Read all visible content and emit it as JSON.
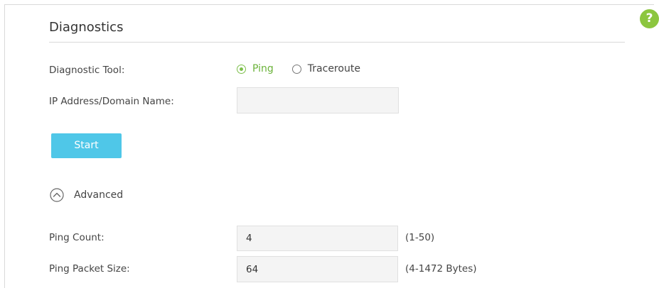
{
  "section": {
    "title": "Diagnostics",
    "help_label": "?"
  },
  "diagnostic_tool": {
    "label": "Diagnostic Tool:",
    "options": [
      {
        "label": "Ping",
        "checked": true
      },
      {
        "label": "Traceroute",
        "checked": false
      }
    ]
  },
  "ip_address": {
    "label": "IP Address/Domain Name:",
    "value": "",
    "placeholder": ""
  },
  "start_button": {
    "label": "Start"
  },
  "advanced": {
    "label": "Advanced",
    "expanded": true
  },
  "ping_count": {
    "label": "Ping Count:",
    "value": "4",
    "hint": "(1-50)"
  },
  "ping_packet_size": {
    "label": "Ping Packet Size:",
    "value": "64",
    "hint": "(4-1472 Bytes)"
  },
  "colors": {
    "accent_green": "#8cc63f",
    "radio_green": "#7cbf4a",
    "start_button_blue": "#4fc7e8"
  }
}
